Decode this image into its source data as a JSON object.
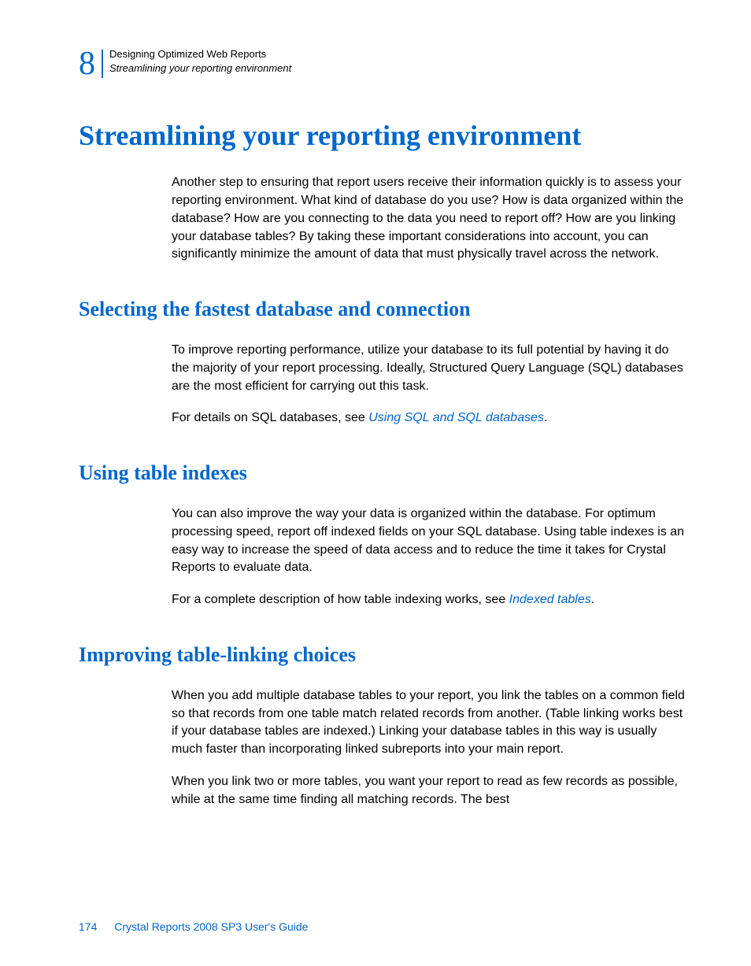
{
  "header": {
    "chapter_number": "8",
    "line1": "Designing Optimized Web Reports",
    "line2": "Streamlining your reporting environment"
  },
  "main_heading": "Streamlining your reporting environment",
  "intro_para": "Another step to ensuring that report users receive their information quickly is to assess your reporting environment. What kind of database do you use? How is data organized within the database? How are you connecting to the data you need to report off? How are you linking your database tables? By taking these important considerations into account, you can significantly minimize the amount of data that must physically travel across the network.",
  "section1": {
    "heading": "Selecting the fastest database and connection",
    "para1": "To improve reporting performance, utilize your database to its full potential by having it do the majority of your report processing. Ideally, Structured Query Language (SQL) databases are the most efficient for carrying out this task.",
    "para2_prefix": "For details on SQL databases, see ",
    "para2_link": "Using SQL and SQL databases",
    "para2_suffix": "."
  },
  "section2": {
    "heading": "Using table indexes",
    "para1": "You can also improve the way your data is organized within the database. For optimum processing speed, report off indexed fields on your SQL database. Using table indexes is an easy way to increase the speed of data access and to reduce the time it takes for Crystal Reports to evaluate data.",
    "para2_prefix": "For a complete description of how table indexing works, see ",
    "para2_link": "Indexed tables",
    "para2_suffix": "."
  },
  "section3": {
    "heading": "Improving table-linking choices",
    "para1": "When you add multiple database tables to your report, you link the tables on a common field so that records from one table match related records from another. (Table linking works best if your database tables are indexed.) Linking your database tables in this way is usually much faster than incorporating linked subreports into your main report.",
    "para2": "When you link two or more tables, you want your report to read as few records as possible, while at the same time finding all matching records. The best"
  },
  "footer": {
    "page_number": "174",
    "doc_title": "Crystal Reports 2008 SP3 User's Guide"
  }
}
